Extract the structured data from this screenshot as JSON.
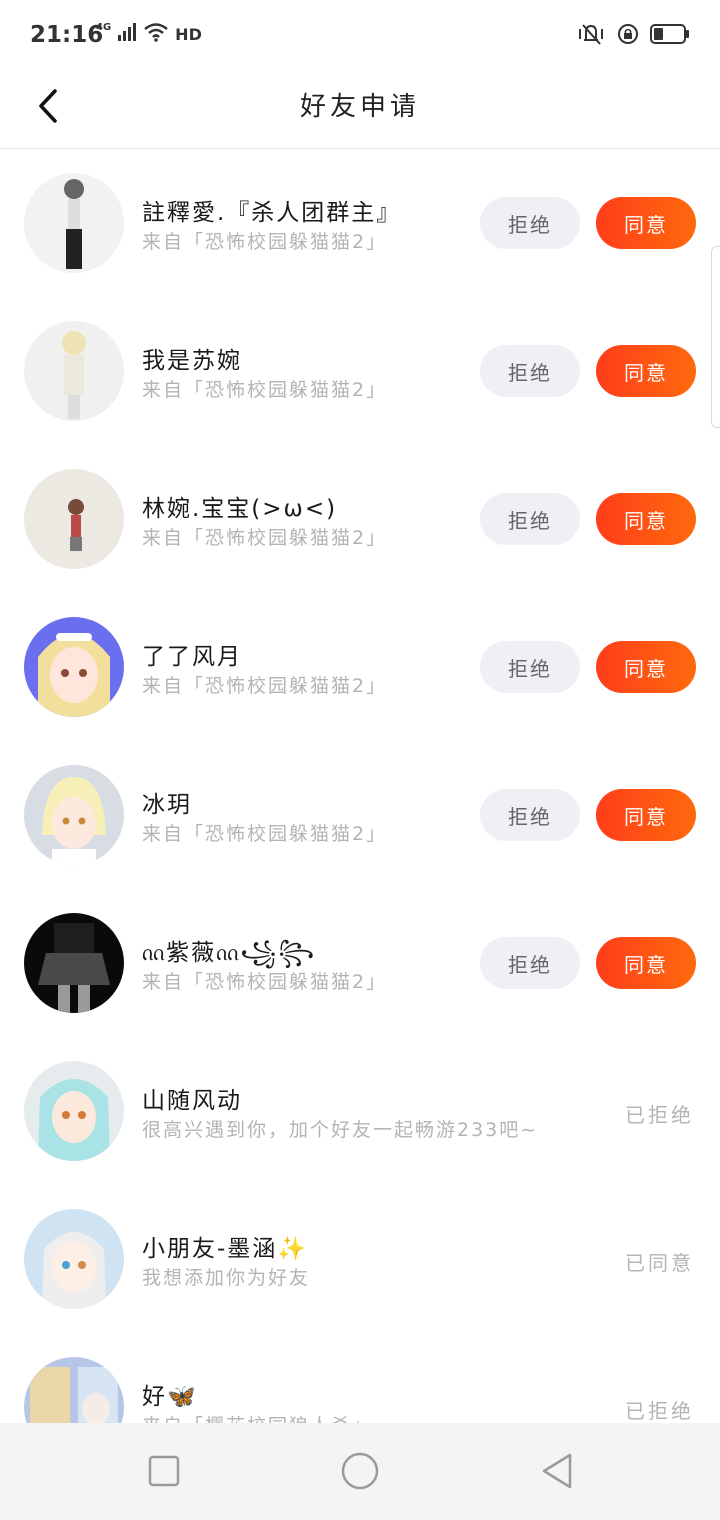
{
  "status_bar": {
    "time": "21:16",
    "network": "4G",
    "hd": "HD",
    "icons": [
      "signal-icon",
      "wifi-icon",
      "hd-icon",
      "vibrate-icon",
      "rotation-lock-icon",
      "battery-icon"
    ]
  },
  "header": {
    "title": "好友申请",
    "back_icon": "chevron-left-icon"
  },
  "colors": {
    "accent_start": "#ff3d1a",
    "accent_end": "#ff6a0d",
    "reject_bg": "#eef0f5",
    "muted_text": "#b4b4b4"
  },
  "requests": [
    {
      "name": "註釋愛.『杀人团群主』",
      "source": "来自「恐怖校园躲猫猫2」",
      "reject_label": "拒绝",
      "accept_label": "同意"
    },
    {
      "name": "我是苏婉",
      "source": "来自「恐怖校园躲猫猫2」",
      "reject_label": "拒绝",
      "accept_label": "同意"
    },
    {
      "name": "林婉.宝宝(>ω<)",
      "source": "来自「恐怖校园躲猫猫2」",
      "reject_label": "拒绝",
      "accept_label": "同意"
    },
    {
      "name": "了了风月",
      "source": "来自「恐怖校园躲猫猫2」",
      "reject_label": "拒绝",
      "accept_label": "同意"
    },
    {
      "name": "冰玥",
      "source": "来自「恐怖校园躲猫猫2」",
      "reject_label": "拒绝",
      "accept_label": "同意"
    },
    {
      "name": "ᦶ紫薇ᦶ꧁꧂",
      "source": "来自「恐怖校园躲猫猫2」",
      "reject_label": "拒绝",
      "accept_label": "同意"
    },
    {
      "name": "山随风动",
      "source": "很高兴遇到你，加个好友一起畅游233吧~",
      "status": "已拒绝"
    },
    {
      "name": "小朋友-墨涵✨",
      "source": "我想添加你为好友",
      "status": "已同意"
    },
    {
      "name": "好🦋",
      "source": "来自「樱花校园狼人杀」",
      "status": "已拒绝"
    }
  ],
  "nav_bar": {
    "icons": [
      "recent-apps-icon",
      "home-icon",
      "back-triangle-icon"
    ]
  }
}
